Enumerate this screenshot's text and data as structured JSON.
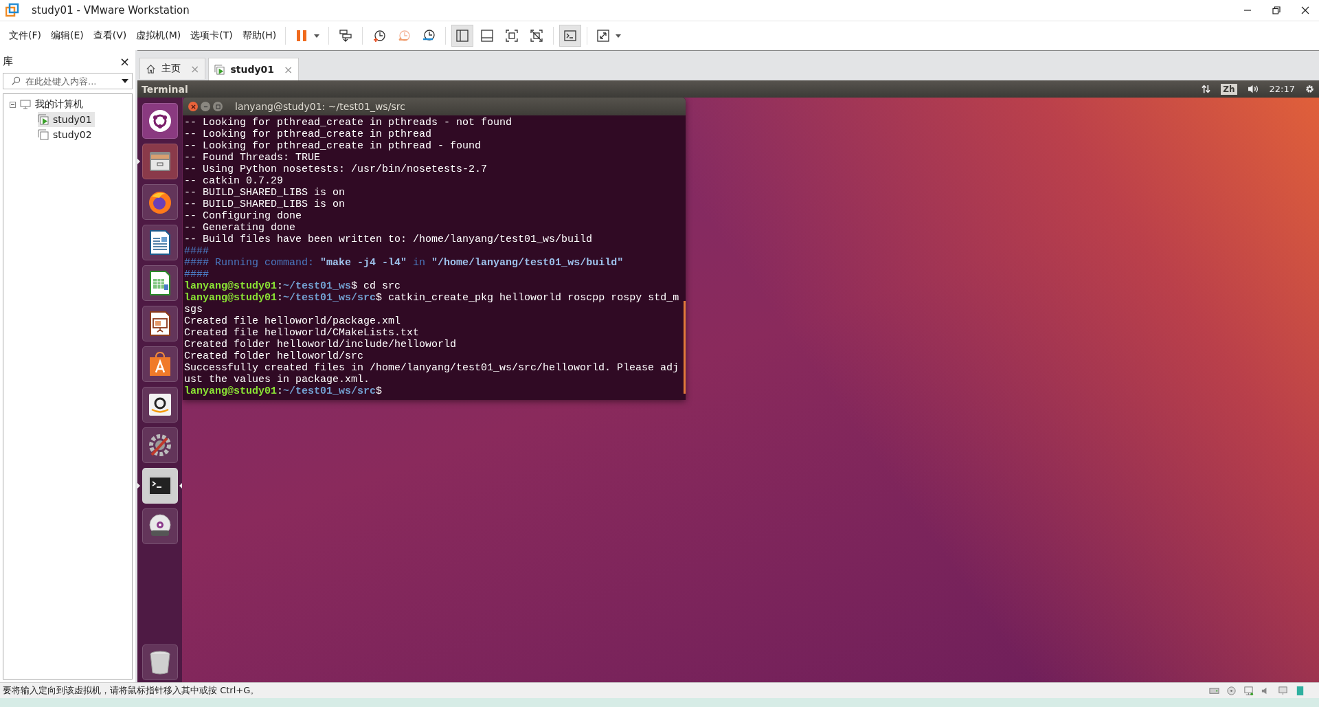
{
  "window": {
    "title": "study01 - VMware Workstation"
  },
  "menu": [
    "文件(F)",
    "编辑(E)",
    "查看(V)",
    "虚拟机(M)",
    "选项卡(T)",
    "帮助(H)"
  ],
  "toolbar": [
    {
      "kind": "pause",
      "selected": false,
      "dropdown": true
    },
    {
      "kind": "send-keys",
      "selected": false,
      "dropdown": false
    },
    {
      "kind": "snapshot-take",
      "selected": false,
      "dropdown": false
    },
    {
      "kind": "snapshot-revert",
      "selected": false,
      "dropdown": false
    },
    {
      "kind": "snapshot-manager",
      "selected": false,
      "dropdown": false
    },
    {
      "kind": "view-library",
      "selected": true,
      "dropdown": false
    },
    {
      "kind": "view-thumbnail",
      "selected": false,
      "dropdown": false
    },
    {
      "kind": "view-fullscreen",
      "selected": false,
      "dropdown": false
    },
    {
      "kind": "view-unity",
      "selected": false,
      "dropdown": false
    },
    {
      "kind": "console",
      "selected": true,
      "dropdown": false
    },
    {
      "kind": "stretch",
      "selected": false,
      "dropdown": true
    }
  ],
  "library": {
    "title": "库",
    "close": "×",
    "search": {
      "placeholder": "在此处键入内容..."
    },
    "tree": [
      {
        "label": "我的计算机",
        "kind": "computer",
        "expanded": true,
        "selected": false,
        "children": [
          {
            "label": "study01",
            "kind": "vm",
            "running": true,
            "selected": true
          },
          {
            "label": "study02",
            "kind": "vm",
            "running": false,
            "selected": false
          }
        ]
      }
    ]
  },
  "tabs": [
    {
      "label": "主页",
      "kind": "home",
      "selected": false,
      "close": "×"
    },
    {
      "label": "study01",
      "kind": "vm",
      "selected": true,
      "close": "×"
    }
  ],
  "guest": {
    "panel": {
      "app_name": "Terminal",
      "input_method": "Zh",
      "time": "22:17"
    },
    "launcher": [
      {
        "kind": "ubuntu",
        "running": false,
        "focused": false
      },
      {
        "kind": "files",
        "running": true,
        "focused": false
      },
      {
        "kind": "firefox",
        "running": false,
        "focused": false
      },
      {
        "kind": "writer",
        "running": false,
        "focused": false
      },
      {
        "kind": "calc",
        "running": false,
        "focused": false
      },
      {
        "kind": "impress",
        "running": false,
        "focused": false
      },
      {
        "kind": "software",
        "running": false,
        "focused": false
      },
      {
        "kind": "amazon",
        "running": false,
        "focused": false
      },
      {
        "kind": "settings",
        "running": false,
        "focused": false
      },
      {
        "kind": "terminal",
        "running": true,
        "focused": true
      },
      {
        "kind": "dvd",
        "running": false,
        "focused": false
      }
    ],
    "trash": {
      "kind": "trash"
    },
    "terminal": {
      "title": "lanyang@study01: ~/test01_ws/src",
      "lines": [
        {
          "segments": [
            {
              "kind": "text",
              "text": "-- Looking for pthread_create in pthreads - not found"
            }
          ]
        },
        {
          "segments": [
            {
              "kind": "text",
              "text": "-- Looking for pthread_create in pthread"
            }
          ]
        },
        {
          "segments": [
            {
              "kind": "text",
              "text": "-- Looking for pthread_create in pthread - found"
            }
          ]
        },
        {
          "segments": [
            {
              "kind": "text",
              "text": "-- Found Threads: TRUE"
            }
          ]
        },
        {
          "segments": [
            {
              "kind": "text",
              "text": "-- Using Python nosetests: /usr/bin/nosetests-2.7"
            }
          ]
        },
        {
          "segments": [
            {
              "kind": "text",
              "text": "-- catkin 0.7.29"
            }
          ]
        },
        {
          "segments": [
            {
              "kind": "text",
              "text": "-- BUILD_SHARED_LIBS is on"
            }
          ]
        },
        {
          "segments": [
            {
              "kind": "text",
              "text": "-- BUILD_SHARED_LIBS is on"
            }
          ]
        },
        {
          "segments": [
            {
              "kind": "text",
              "text": "-- Configuring done"
            }
          ]
        },
        {
          "segments": [
            {
              "kind": "text",
              "text": "-- Generating done"
            }
          ]
        },
        {
          "segments": [
            {
              "kind": "text",
              "text": "-- Build files have been written to: /home/lanyang/test01_ws/build"
            }
          ]
        },
        {
          "segments": [
            {
              "kind": "comment",
              "text": "####"
            }
          ]
        },
        {
          "segments": [
            {
              "kind": "comment",
              "text": "#### Running command: "
            },
            {
              "kind": "quoted",
              "text": "\"make -j4 -l4\""
            },
            {
              "kind": "comment",
              "text": " in "
            },
            {
              "kind": "quoted",
              "text": "\"/home/lanyang/test01_ws/build\""
            }
          ]
        },
        {
          "segments": [
            {
              "kind": "comment",
              "text": "####"
            }
          ]
        },
        {
          "segments": [
            {
              "kind": "user",
              "text": "lanyang@study01"
            },
            {
              "kind": "text",
              "text": ":"
            },
            {
              "kind": "path",
              "text": "~/test01_ws"
            },
            {
              "kind": "text",
              "text": "$ cd src"
            }
          ]
        },
        {
          "segments": [
            {
              "kind": "user",
              "text": "lanyang@study01"
            },
            {
              "kind": "text",
              "text": ":"
            },
            {
              "kind": "path",
              "text": "~/test01_ws/src"
            },
            {
              "kind": "text",
              "text": "$ catkin_create_pkg helloworld roscpp rospy std_m"
            }
          ]
        },
        {
          "segments": [
            {
              "kind": "text",
              "text": "sgs"
            }
          ]
        },
        {
          "segments": [
            {
              "kind": "text",
              "text": "Created file helloworld/package.xml"
            }
          ]
        },
        {
          "segments": [
            {
              "kind": "text",
              "text": "Created file helloworld/CMakeLists.txt"
            }
          ]
        },
        {
          "segments": [
            {
              "kind": "text",
              "text": "Created folder helloworld/include/helloworld"
            }
          ]
        },
        {
          "segments": [
            {
              "kind": "text",
              "text": "Created folder helloworld/src"
            }
          ]
        },
        {
          "segments": [
            {
              "kind": "text",
              "text": "Successfully created files in /home/lanyang/test01_ws/src/helloworld. Please adj"
            }
          ]
        },
        {
          "segments": [
            {
              "kind": "text",
              "text": "ust the values in package.xml."
            }
          ]
        },
        {
          "segments": [
            {
              "kind": "user",
              "text": "lanyang@study01"
            },
            {
              "kind": "text",
              "text": ":"
            },
            {
              "kind": "path",
              "text": "~/test01_ws/src"
            },
            {
              "kind": "text",
              "text": "$"
            }
          ]
        }
      ]
    }
  },
  "status_bar": {
    "message": "要将输入定向到该虚拟机，请将鼠标指针移入其中或按 Ctrl+G。"
  }
}
